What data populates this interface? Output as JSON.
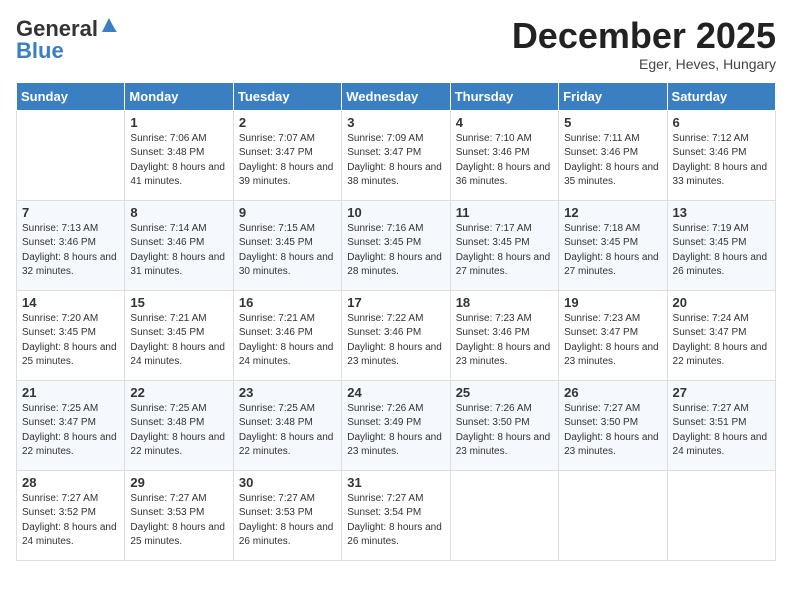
{
  "logo": {
    "general": "General",
    "blue": "Blue"
  },
  "header": {
    "month": "December 2025",
    "location": "Eger, Heves, Hungary"
  },
  "weekdays": [
    "Sunday",
    "Monday",
    "Tuesday",
    "Wednesday",
    "Thursday",
    "Friday",
    "Saturday"
  ],
  "weeks": [
    [
      {
        "day": "",
        "sunrise": "",
        "sunset": "",
        "daylight": ""
      },
      {
        "day": "1",
        "sunrise": "Sunrise: 7:06 AM",
        "sunset": "Sunset: 3:48 PM",
        "daylight": "Daylight: 8 hours and 41 minutes."
      },
      {
        "day": "2",
        "sunrise": "Sunrise: 7:07 AM",
        "sunset": "Sunset: 3:47 PM",
        "daylight": "Daylight: 8 hours and 39 minutes."
      },
      {
        "day": "3",
        "sunrise": "Sunrise: 7:09 AM",
        "sunset": "Sunset: 3:47 PM",
        "daylight": "Daylight: 8 hours and 38 minutes."
      },
      {
        "day": "4",
        "sunrise": "Sunrise: 7:10 AM",
        "sunset": "Sunset: 3:46 PM",
        "daylight": "Daylight: 8 hours and 36 minutes."
      },
      {
        "day": "5",
        "sunrise": "Sunrise: 7:11 AM",
        "sunset": "Sunset: 3:46 PM",
        "daylight": "Daylight: 8 hours and 35 minutes."
      },
      {
        "day": "6",
        "sunrise": "Sunrise: 7:12 AM",
        "sunset": "Sunset: 3:46 PM",
        "daylight": "Daylight: 8 hours and 33 minutes."
      }
    ],
    [
      {
        "day": "7",
        "sunrise": "Sunrise: 7:13 AM",
        "sunset": "Sunset: 3:46 PM",
        "daylight": "Daylight: 8 hours and 32 minutes."
      },
      {
        "day": "8",
        "sunrise": "Sunrise: 7:14 AM",
        "sunset": "Sunset: 3:46 PM",
        "daylight": "Daylight: 8 hours and 31 minutes."
      },
      {
        "day": "9",
        "sunrise": "Sunrise: 7:15 AM",
        "sunset": "Sunset: 3:45 PM",
        "daylight": "Daylight: 8 hours and 30 minutes."
      },
      {
        "day": "10",
        "sunrise": "Sunrise: 7:16 AM",
        "sunset": "Sunset: 3:45 PM",
        "daylight": "Daylight: 8 hours and 28 minutes."
      },
      {
        "day": "11",
        "sunrise": "Sunrise: 7:17 AM",
        "sunset": "Sunset: 3:45 PM",
        "daylight": "Daylight: 8 hours and 27 minutes."
      },
      {
        "day": "12",
        "sunrise": "Sunrise: 7:18 AM",
        "sunset": "Sunset: 3:45 PM",
        "daylight": "Daylight: 8 hours and 27 minutes."
      },
      {
        "day": "13",
        "sunrise": "Sunrise: 7:19 AM",
        "sunset": "Sunset: 3:45 PM",
        "daylight": "Daylight: 8 hours and 26 minutes."
      }
    ],
    [
      {
        "day": "14",
        "sunrise": "Sunrise: 7:20 AM",
        "sunset": "Sunset: 3:45 PM",
        "daylight": "Daylight: 8 hours and 25 minutes."
      },
      {
        "day": "15",
        "sunrise": "Sunrise: 7:21 AM",
        "sunset": "Sunset: 3:45 PM",
        "daylight": "Daylight: 8 hours and 24 minutes."
      },
      {
        "day": "16",
        "sunrise": "Sunrise: 7:21 AM",
        "sunset": "Sunset: 3:46 PM",
        "daylight": "Daylight: 8 hours and 24 minutes."
      },
      {
        "day": "17",
        "sunrise": "Sunrise: 7:22 AM",
        "sunset": "Sunset: 3:46 PM",
        "daylight": "Daylight: 8 hours and 23 minutes."
      },
      {
        "day": "18",
        "sunrise": "Sunrise: 7:23 AM",
        "sunset": "Sunset: 3:46 PM",
        "daylight": "Daylight: 8 hours and 23 minutes."
      },
      {
        "day": "19",
        "sunrise": "Sunrise: 7:23 AM",
        "sunset": "Sunset: 3:47 PM",
        "daylight": "Daylight: 8 hours and 23 minutes."
      },
      {
        "day": "20",
        "sunrise": "Sunrise: 7:24 AM",
        "sunset": "Sunset: 3:47 PM",
        "daylight": "Daylight: 8 hours and 22 minutes."
      }
    ],
    [
      {
        "day": "21",
        "sunrise": "Sunrise: 7:25 AM",
        "sunset": "Sunset: 3:47 PM",
        "daylight": "Daylight: 8 hours and 22 minutes."
      },
      {
        "day": "22",
        "sunrise": "Sunrise: 7:25 AM",
        "sunset": "Sunset: 3:48 PM",
        "daylight": "Daylight: 8 hours and 22 minutes."
      },
      {
        "day": "23",
        "sunrise": "Sunrise: 7:25 AM",
        "sunset": "Sunset: 3:48 PM",
        "daylight": "Daylight: 8 hours and 22 minutes."
      },
      {
        "day": "24",
        "sunrise": "Sunrise: 7:26 AM",
        "sunset": "Sunset: 3:49 PM",
        "daylight": "Daylight: 8 hours and 23 minutes."
      },
      {
        "day": "25",
        "sunrise": "Sunrise: 7:26 AM",
        "sunset": "Sunset: 3:50 PM",
        "daylight": "Daylight: 8 hours and 23 minutes."
      },
      {
        "day": "26",
        "sunrise": "Sunrise: 7:27 AM",
        "sunset": "Sunset: 3:50 PM",
        "daylight": "Daylight: 8 hours and 23 minutes."
      },
      {
        "day": "27",
        "sunrise": "Sunrise: 7:27 AM",
        "sunset": "Sunset: 3:51 PM",
        "daylight": "Daylight: 8 hours and 24 minutes."
      }
    ],
    [
      {
        "day": "28",
        "sunrise": "Sunrise: 7:27 AM",
        "sunset": "Sunset: 3:52 PM",
        "daylight": "Daylight: 8 hours and 24 minutes."
      },
      {
        "day": "29",
        "sunrise": "Sunrise: 7:27 AM",
        "sunset": "Sunset: 3:53 PM",
        "daylight": "Daylight: 8 hours and 25 minutes."
      },
      {
        "day": "30",
        "sunrise": "Sunrise: 7:27 AM",
        "sunset": "Sunset: 3:53 PM",
        "daylight": "Daylight: 8 hours and 26 minutes."
      },
      {
        "day": "31",
        "sunrise": "Sunrise: 7:27 AM",
        "sunset": "Sunset: 3:54 PM",
        "daylight": "Daylight: 8 hours and 26 minutes."
      },
      {
        "day": "",
        "sunrise": "",
        "sunset": "",
        "daylight": ""
      },
      {
        "day": "",
        "sunrise": "",
        "sunset": "",
        "daylight": ""
      },
      {
        "day": "",
        "sunrise": "",
        "sunset": "",
        "daylight": ""
      }
    ]
  ]
}
